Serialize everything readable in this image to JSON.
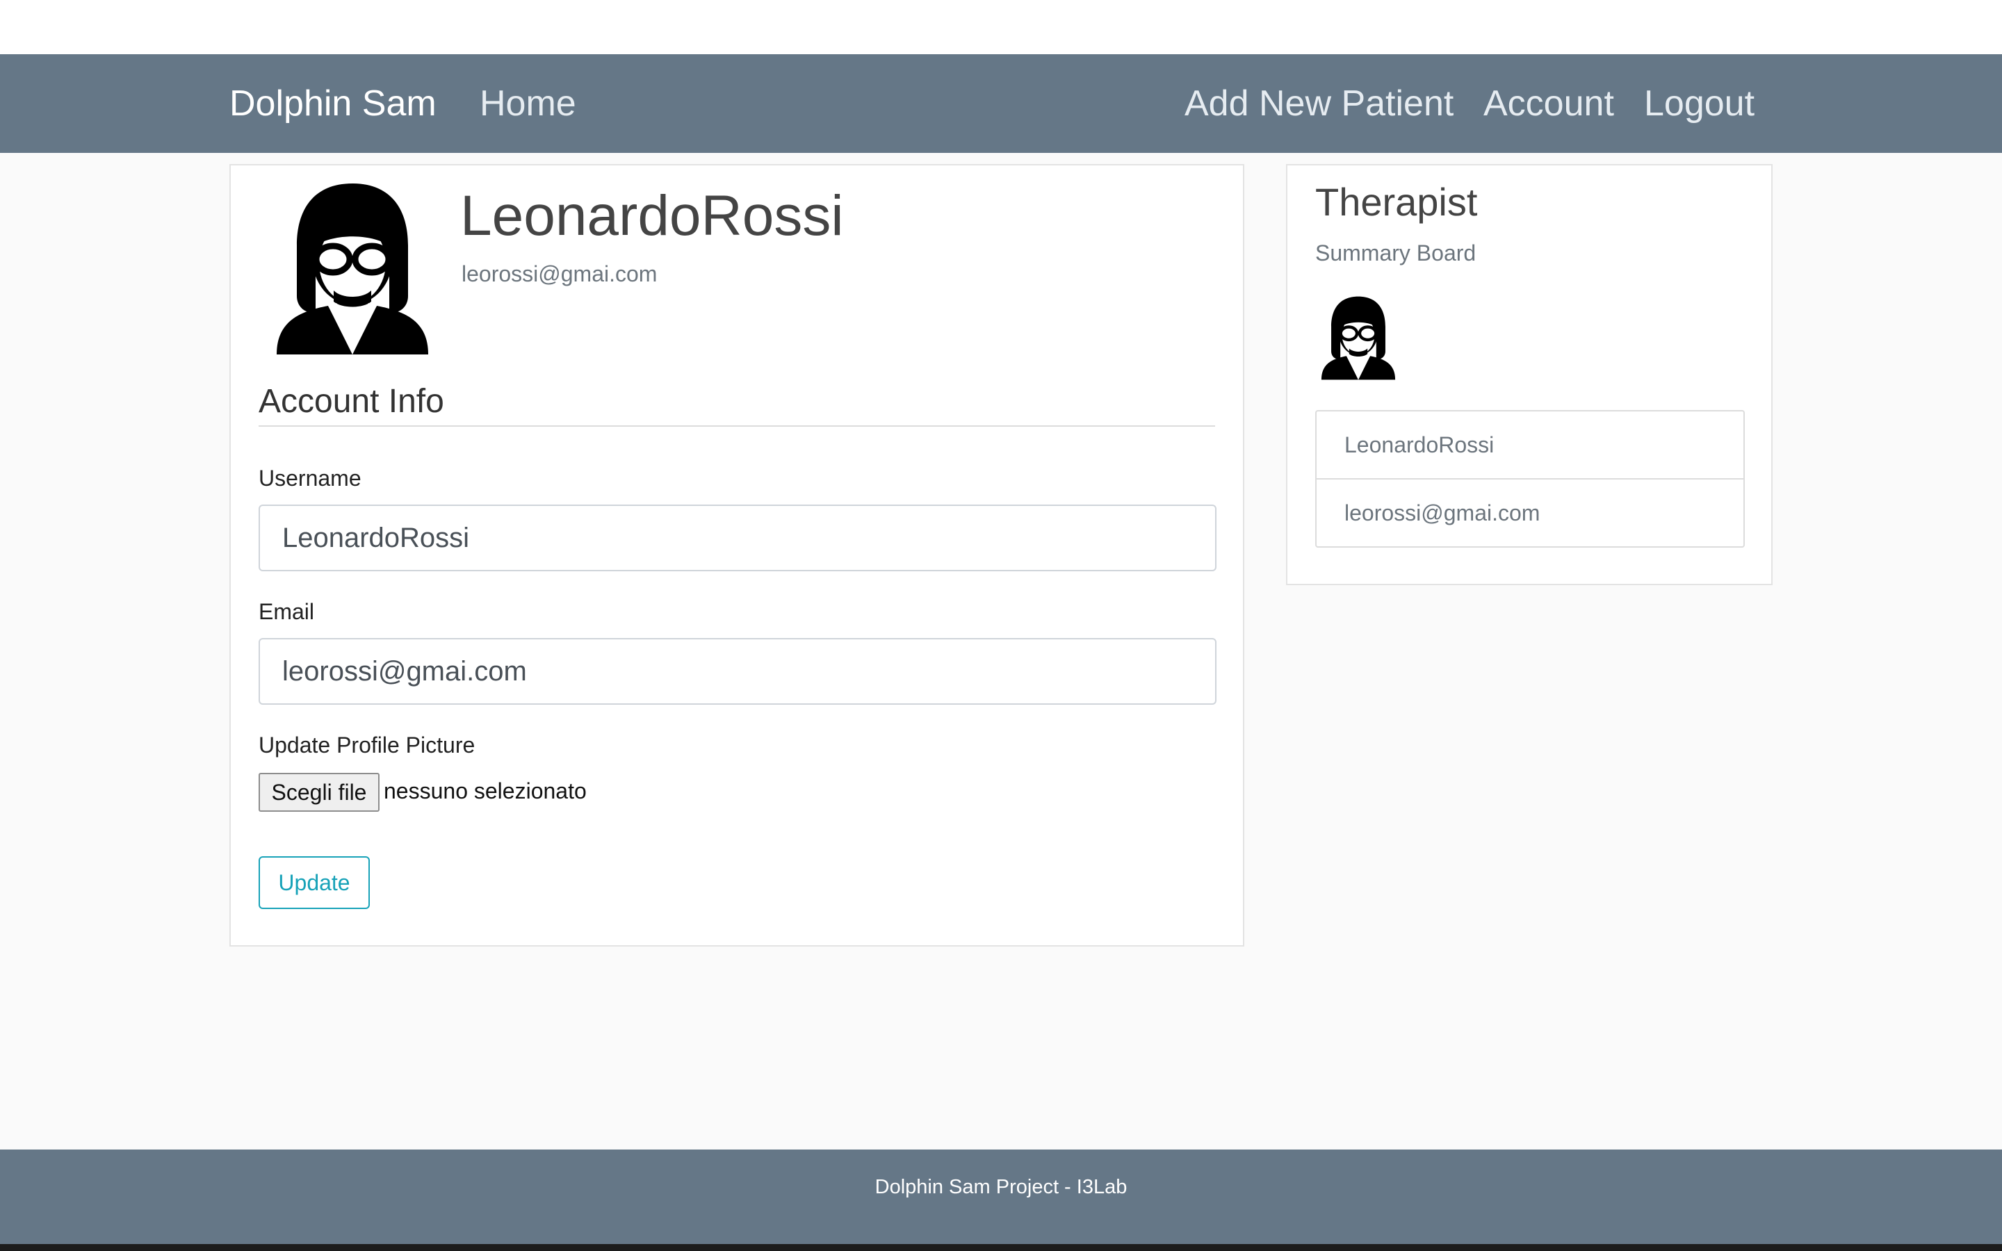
{
  "navbar": {
    "brand": "Dolphin Sam",
    "home": "Home",
    "add_patient": "Add New Patient",
    "account": "Account",
    "logout": "Logout"
  },
  "profile": {
    "avatar_icon": "therapist-avatar-icon",
    "name": "LeonardoRossi",
    "email": "leorossi@gmai.com"
  },
  "account_info": {
    "title": "Account Info",
    "username_label": "Username",
    "username_value": "LeonardoRossi",
    "email_label": "Email",
    "email_value": "leorossi@gmai.com",
    "picture_label": "Update Profile Picture",
    "file_button": "Scegli file",
    "file_status": "nessuno selezionato",
    "update_button": "Update"
  },
  "sidebar": {
    "title": "Therapist",
    "subtitle": "Summary Board",
    "avatar_icon": "therapist-avatar-icon",
    "items": [
      {
        "label": "LeonardoRossi"
      },
      {
        "label": "leorossi@gmai.com"
      }
    ]
  },
  "footer": {
    "text": "Dolphin Sam Project - I3Lab"
  },
  "colors": {
    "navbar": "#657787",
    "accent": "#17a2b8",
    "background": "#fafafa"
  }
}
